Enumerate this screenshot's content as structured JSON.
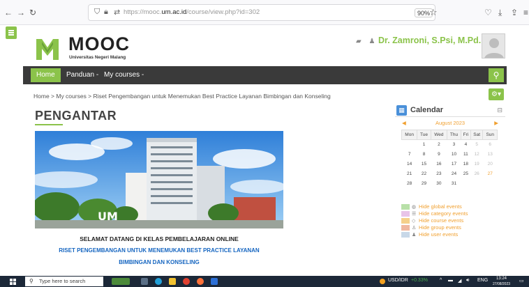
{
  "browser": {
    "url_prefix": "https://mooc.",
    "url_domain": "um.ac.id",
    "url_path": "/course/view.php?id=302",
    "zoom": "90%"
  },
  "header": {
    "logo_title": "MOOC",
    "logo_subtitle": "Universitas Negeri Malang",
    "username": "Dr. Zamroni, S.Psi, M.Pd. -"
  },
  "nav": {
    "home": "Home",
    "panduan": "Panduan -",
    "my_courses": "My courses -"
  },
  "breadcrumb": "Home > My courses > Riset Pengembangan untuk Menemukan Best Practice Layanan Bimbingan dan Konseling",
  "main": {
    "title": "PENGANTAR",
    "welcome_line1": "SELAMAT DATANG DI KELAS PEMBELAJARAN ONLINE",
    "welcome_line2": "RISET PENGEMBANGAN UNTUK MENEMUKAN BEST PRACTICE LAYANAN",
    "welcome_line3": "BIMBINGAN DAN KONSELING"
  },
  "calendar": {
    "title": "Calendar",
    "month": "August 2023",
    "days": [
      "Mon",
      "Tue",
      "Wed",
      "Thu",
      "Fri",
      "Sat",
      "Sun"
    ],
    "weeks": [
      [
        "",
        "1",
        "2",
        "3",
        "4",
        "5",
        "6"
      ],
      [
        "7",
        "8",
        "9",
        "10",
        "11",
        "12",
        "13"
      ],
      [
        "14",
        "15",
        "16",
        "17",
        "18",
        "19",
        "20"
      ],
      [
        "21",
        "22",
        "23",
        "24",
        "25",
        "26",
        "27"
      ],
      [
        "28",
        "29",
        "30",
        "31",
        "",
        "",
        ""
      ]
    ],
    "legend": [
      {
        "label": "Hide global events",
        "color": "#b8e0a8",
        "icon": "globe-icon"
      },
      {
        "label": "Hide category events",
        "color": "#e8c4e8",
        "icon": "category-icon"
      },
      {
        "label": "Hide course events",
        "color": "#f5d08a",
        "icon": "course-icon"
      },
      {
        "label": "Hide group events",
        "color": "#f0b8a0",
        "icon": "group-icon"
      },
      {
        "label": "Hide user events",
        "color": "#c8d8e8",
        "icon": "user-icon"
      }
    ]
  },
  "taskbar": {
    "search_placeholder": "Type here to search",
    "ticker": "USD/IDR",
    "ticker_change": "+0.33%",
    "lang": "ENG",
    "time": "13:24",
    "date": "27/08/2023"
  },
  "colors": {
    "accent": "#8bc34a",
    "nav_bg": "#3a3a3a",
    "calendar_link": "#f0a030",
    "welcome_blue": "#1565c0"
  }
}
